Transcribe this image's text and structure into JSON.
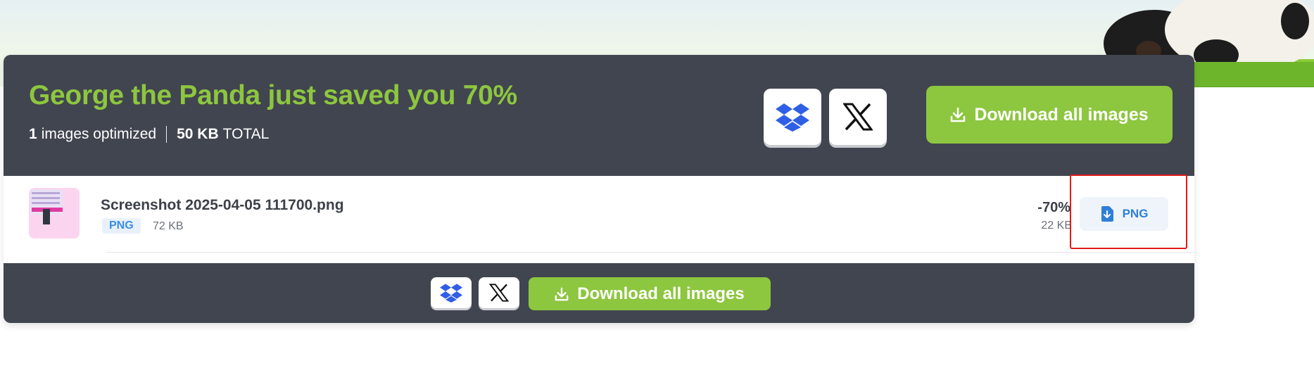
{
  "summary_panel": {
    "headline": "George the Panda just saved you 70%",
    "images_count": "1",
    "images_text": "images optimized",
    "total_size": "50 KB",
    "total_text": "TOTAL",
    "download_all_label": "Download all images"
  },
  "file_row": {
    "filename": "Screenshot 2025-04-05 111700.png",
    "format": "PNG",
    "original_size": "72 KB",
    "saving_percent": "-70%",
    "new_size": "22 KB",
    "download_label": "PNG"
  },
  "icons": {
    "dropbox": "dropbox-icon",
    "x": "x-logo-icon",
    "download": "download-icon",
    "file_download": "file-download-icon"
  },
  "colors": {
    "accent_green": "#8dc63f",
    "panel_bg": "#41454f",
    "link_blue": "#2f7fd8",
    "highlight_red": "#e21b1b"
  }
}
